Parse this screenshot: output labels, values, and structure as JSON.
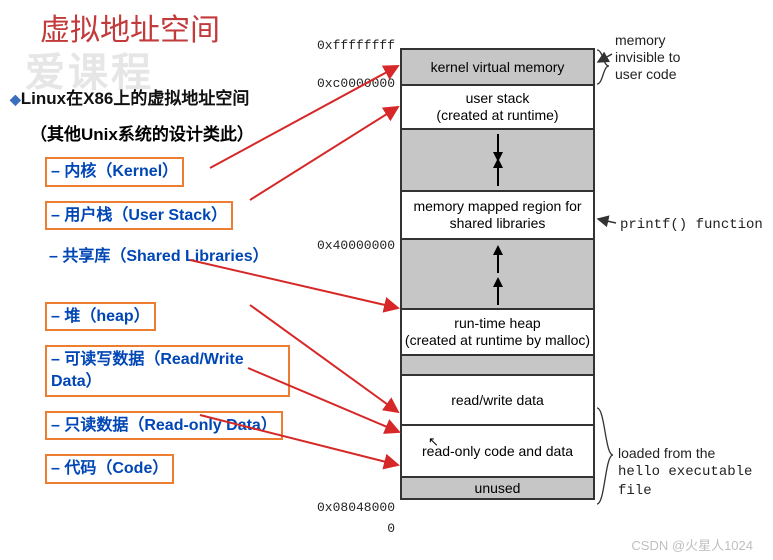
{
  "title": "虚拟地址空间",
  "watermark": "爱课程",
  "main_heading": "Linux在X86上的虚拟地址空间",
  "sub_heading": "（其他Unix系统的设计类此）",
  "bullets": [
    {
      "text": "– 内核（Kernel）",
      "boxed": true
    },
    {
      "text": "– 用户栈（User Stack）",
      "boxed": true
    },
    {
      "text": "– 共享库（Shared Libraries）",
      "boxed": false
    },
    {
      "text": "– 堆（heap）",
      "boxed": true
    },
    {
      "text": "– 可读写数据（Read/Write Data）",
      "boxed": true
    },
    {
      "text": "– 只读数据（Read-only Data）",
      "boxed": true
    },
    {
      "text": "– 代码（Code）",
      "boxed": true
    }
  ],
  "addresses": {
    "top": "0xffffffff",
    "user_stack_top": "0xc0000000",
    "shared_lib_top": "0x40000000",
    "code_start": "0x08048000",
    "bottom": "0"
  },
  "segments": {
    "kernel": "kernel virtual memory",
    "user_stack_l1": "user stack",
    "user_stack_l2": "(created at runtime)",
    "mmap_l1": "memory mapped region for",
    "mmap_l2": "shared libraries",
    "heap_l1": "run-time heap",
    "heap_l2": "(created at runtime by malloc)",
    "rwdata": "read/write data",
    "rodata": "read-only code and data",
    "unused": "unused"
  },
  "right_labels": {
    "mem_invisible_l1": "memory",
    "mem_invisible_l2": "invisible to",
    "mem_invisible_l3": "user code",
    "printf": "printf() function",
    "loaded_l1": "loaded from the",
    "loaded_l2": "hello executable file"
  },
  "csdn": "CSDN @火星人1024"
}
